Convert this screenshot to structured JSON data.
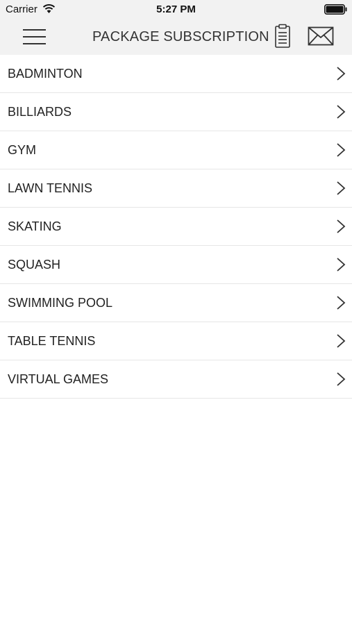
{
  "status_bar": {
    "carrier": "Carrier",
    "time": "5:27 PM"
  },
  "header": {
    "title": "PACKAGE SUBSCRIPTION",
    "icons": [
      "menu-icon",
      "clipboard-icon",
      "mail-icon"
    ]
  },
  "packages": [
    {
      "label": "BADMINTON"
    },
    {
      "label": "BILLIARDS"
    },
    {
      "label": "GYM"
    },
    {
      "label": "LAWN TENNIS"
    },
    {
      "label": "SKATING"
    },
    {
      "label": "SQUASH"
    },
    {
      "label": "SWIMMING POOL"
    },
    {
      "label": "TABLE TENNIS"
    },
    {
      "label": "VIRTUAL GAMES"
    }
  ],
  "colors": {
    "bar_background": "#f2f2f2",
    "separator": "#e6e6e6",
    "text": "#222222"
  }
}
